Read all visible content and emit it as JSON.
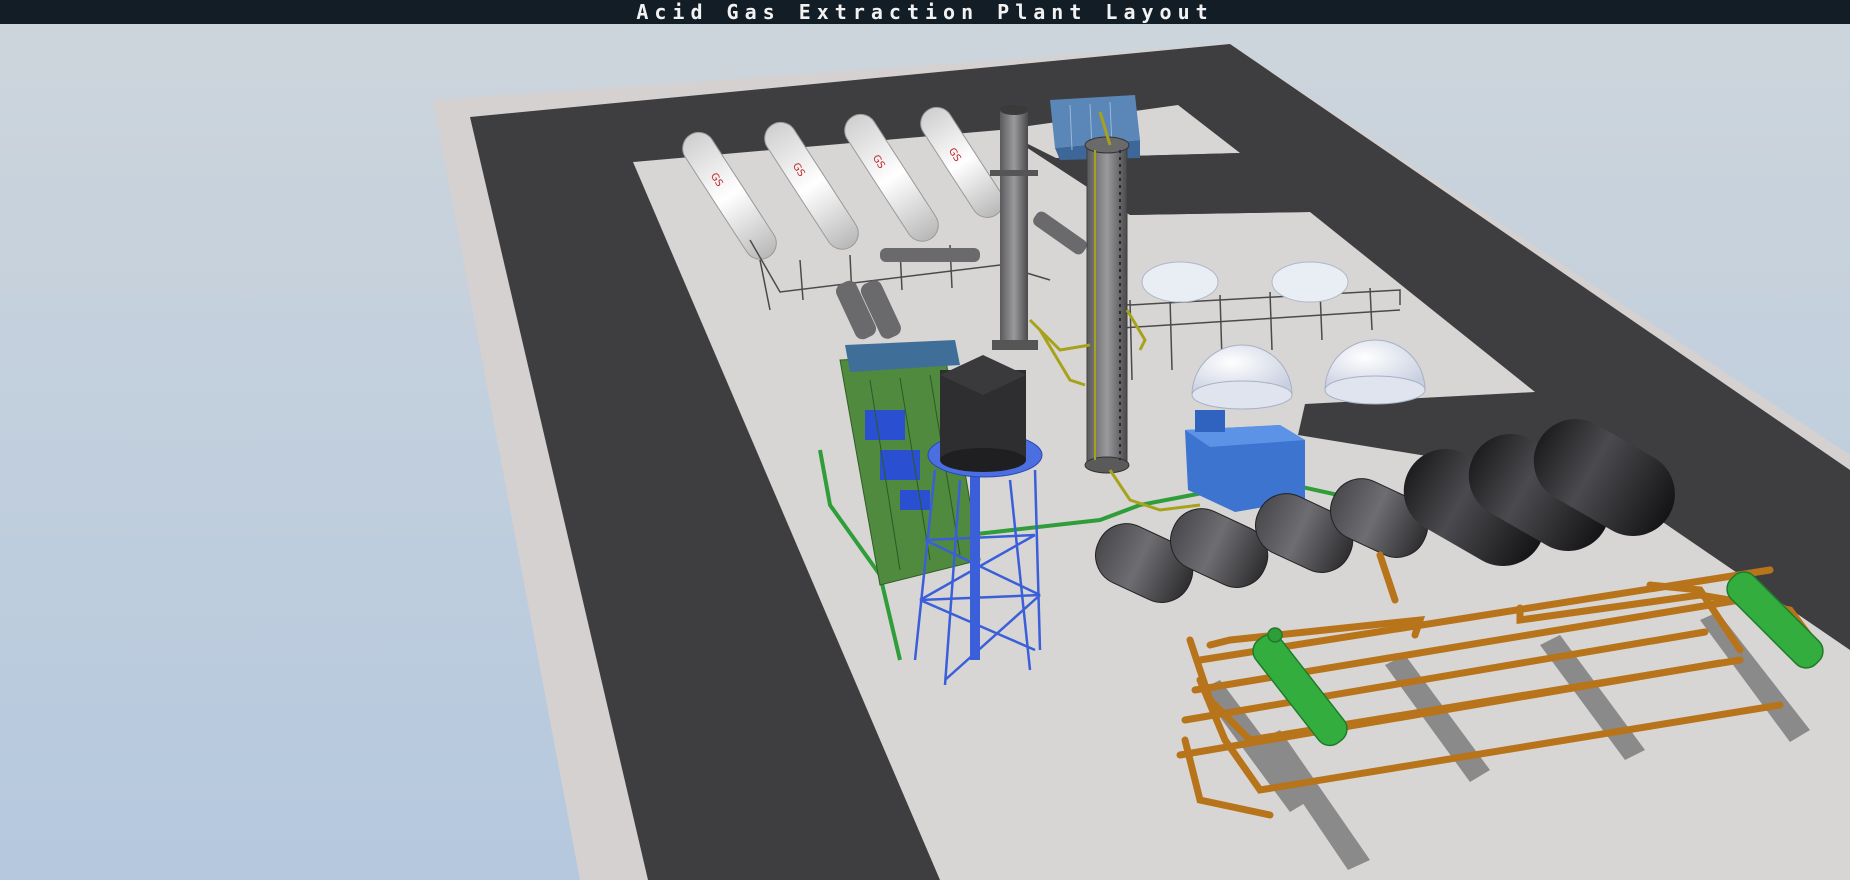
{
  "window": {
    "title": "Acid Gas Extraction Plant Layout"
  },
  "scene": {
    "description_kind": "3d-isometric-viewport",
    "colors": {
      "sky": "#c4cfd9",
      "curb": "#d6d3d2",
      "asphalt": "#3d3d3f",
      "concrete": "#d8d5d3",
      "orange_pipe": "#b8741a",
      "green_pipe": "#2f9e3a",
      "blue_steel": "#3b5fd9",
      "dark_tank": "#2d2d30",
      "yellow_pipe": "#a7a21c"
    },
    "equipment": [
      "storage-tanker-row",
      "exhaust-stack",
      "distillation-column",
      "water-tower",
      "spherical-domes",
      "pump-skid",
      "horizontal-silver-tanks",
      "horizontal-black-tanks",
      "pipe-rack",
      "control-container",
      "green-generator-unit"
    ]
  }
}
